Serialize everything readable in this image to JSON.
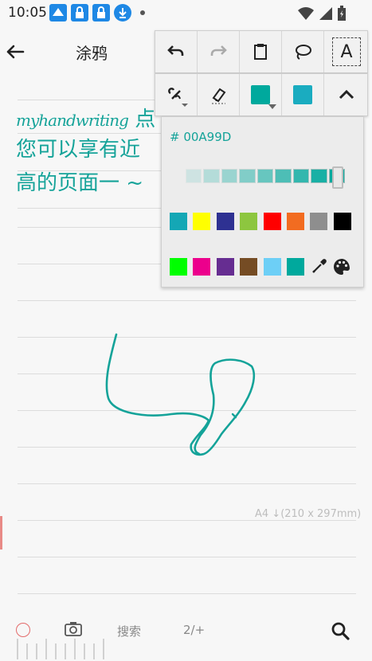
{
  "status_bar": {
    "time": "10:05"
  },
  "header": {
    "title": "涂鸦"
  },
  "note": {
    "line1_script": "myhandwriting",
    "line1_text": "点 涂鸦",
    "line2_text": "您可以享有近",
    "line3_text": "高的页面一",
    "page_size": "A4 ↓(210 x 297mm)"
  },
  "toolbar": {
    "row1": [
      "undo-icon",
      "redo-icon",
      "clipboard-icon",
      "lasso-icon",
      "text-tool-icon"
    ],
    "text_tool_label": "A",
    "row2": [
      "pen-settings-icon",
      "eraser-icon",
      "pen-color-swatch",
      "highlight-color-swatch",
      "collapse-icon"
    ],
    "pen_color": "#00A99D",
    "highlight_color": "#1AACC0"
  },
  "color_panel": {
    "hex_value": "# 00A99D",
    "opacity_segments": 9,
    "swatches_row1": [
      "#14A7B5",
      "#FFFF00",
      "#2E3192",
      "#8DC63F",
      "#FF0000",
      "#F26C21",
      "#8E8E8E",
      "#000000"
    ],
    "swatches_row2": [
      "#00FF00",
      "#EC008C",
      "#662D91",
      "#754C24",
      "#6DCFF6",
      "#00A99D"
    ],
    "tools_row2": [
      "eyedropper-icon",
      "palette-icon"
    ]
  },
  "bottom_bar": {
    "search_label": "搜索",
    "page_indicator": "2/+"
  }
}
